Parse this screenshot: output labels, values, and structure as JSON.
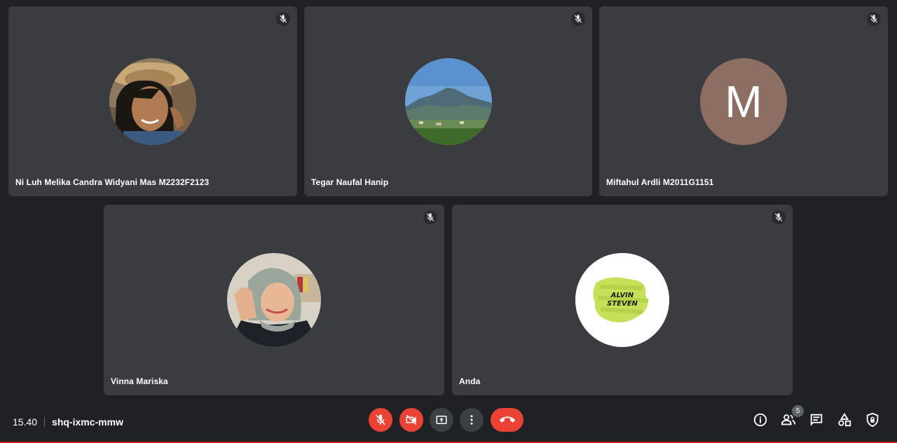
{
  "participants": [
    {
      "name": "Ni Luh Melika Candra Widyani Mas M2232F2123",
      "avatar": "photo-woman-hat"
    },
    {
      "name": "Tegar Naufal Hanip",
      "avatar": "photo-mountain"
    },
    {
      "name": "Miftahul Ardli M2011G1151",
      "avatar": "letter",
      "initial": "M",
      "avatar_color": "#8d6e63"
    },
    {
      "name": "Vinna Mariska",
      "avatar": "photo-woman-hijab"
    },
    {
      "name": "Anda",
      "avatar": "logo-alvin-steven",
      "logo_text_line1": "ALVIN",
      "logo_text_line2": "STEVEN"
    }
  ],
  "meeting": {
    "time": "15.40",
    "code": "shq-ixmc-mmw"
  },
  "controls": {
    "mic": "mic-off-icon",
    "camera": "camera-off-icon",
    "present": "present-screen-icon",
    "more": "more-vert-icon",
    "leave": "call-end-icon"
  },
  "side_controls": {
    "people_count": "5",
    "icons": [
      "info-icon",
      "people-icon",
      "chat-icon",
      "activities-icon",
      "host-controls-icon"
    ]
  },
  "colors": {
    "background": "#202124",
    "tile": "#3b3c40",
    "danger": "#ea4335",
    "logo_green": "#c5e15a"
  }
}
